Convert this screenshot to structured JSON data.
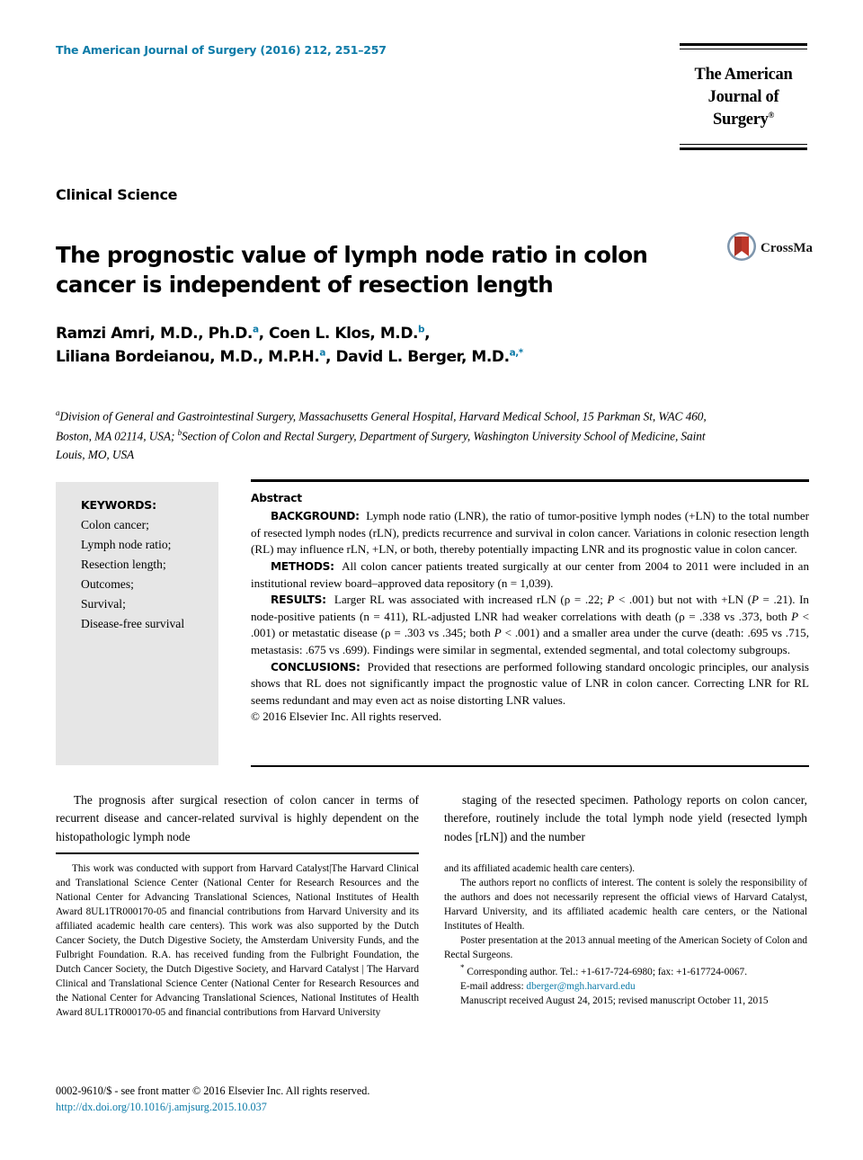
{
  "header": {
    "journal_reference": "The American Journal of Surgery (2016) 212, 251–257",
    "masthead_line1": "The American",
    "masthead_line2": "Journal of Surgery",
    "masthead_registered": "®"
  },
  "article": {
    "section_label": "Clinical Science",
    "title": "The prognostic value of lymph node ratio in colon cancer is independent of resection length",
    "crossmark_label": "CrossMark",
    "crossmark_ring_color": "#5a7fa6",
    "crossmark_ribbon_color": "#c0392b",
    "accent_color": "#0d7ba8"
  },
  "authors": {
    "line1": "Ramzi Amri, M.D., Ph.D.",
    "line1_sup1": "a",
    "line1_mid": ", Coen L. Klos, M.D.",
    "line1_sup2": "b",
    "line1_end": ",",
    "line2": "Liliana Bordeianou, M.D., M.P.H.",
    "line2_sup1": "a",
    "line2_mid": ", David L. Berger, M.D.",
    "line2_sup2": "a,*"
  },
  "affiliations": {
    "sup_a": "a",
    "text_a": "Division of General and Gastrointestinal Surgery, Massachusetts General Hospital, Harvard Medical School, 15 Parkman St, WAC 460, Boston, MA 02114, USA; ",
    "sup_b": "b",
    "text_b": "Section of Colon and Rectal Surgery, Department of Surgery, Washington University School of Medicine, Saint Louis, MO, USA"
  },
  "keywords": {
    "title": "KEYWORDS:",
    "items": [
      "Colon cancer;",
      "Lymph node ratio;",
      "Resection length;",
      "Outcomes;",
      "Survival;",
      "Disease-free survival"
    ]
  },
  "abstract": {
    "heading": "Abstract",
    "background_label": "BACKGROUND:",
    "background_text": "Lymph node ratio (LNR), the ratio of tumor-positive lymph nodes (+LN) to the total number of resected lymph nodes (rLN), predicts recurrence and survival in colon cancer. Variations in colonic resection length (RL) may influence rLN, +LN, or both, thereby potentially impacting LNR and its prognostic value in colon cancer.",
    "methods_label": "METHODS:",
    "methods_text": "All colon cancer patients treated surgically at our center from 2004 to 2011 were included in an institutional review board–approved data repository (n = 1,039).",
    "results_label": "RESULTS:",
    "results_text_1": "Larger RL was associated with increased rLN (ρ = .22; ",
    "results_p1": "P",
    "results_text_2": " < .001) but not with +LN (",
    "results_p2": "P",
    "results_text_3": " = .21). In node-positive patients (n = 411), RL-adjusted LNR had weaker correlations with death (ρ = .338 vs .373, both ",
    "results_p3": "P",
    "results_text_4": " < .001) or metastatic disease (ρ = .303 vs .345; both ",
    "results_p4": "P",
    "results_text_5": " < .001) and a smaller area under the curve (death: .695 vs .715, metastasis: .675 vs .699). Findings were similar in segmental, extended segmental, and total colectomy subgroups.",
    "conclusions_label": "CONCLUSIONS:",
    "conclusions_text": "Provided that resections are performed following standard oncologic principles, our analysis shows that RL does not significantly impact the prognostic value of LNR in colon cancer. Correcting LNR for RL seems redundant and may even act as noise distorting LNR values.",
    "copyright": "© 2016 Elsevier Inc. All rights reserved."
  },
  "body": {
    "left_column": "The prognosis after surgical resection of colon cancer in terms of recurrent disease and cancer-related survival is highly dependent on the histopathologic lymph node",
    "right_column": "staging of the resected specimen. Pathology reports on colon cancer, therefore, routinely include the total lymph node yield (resected lymph nodes [rLN]) and the number"
  },
  "footnotes": {
    "left_para_1": "This work was conducted with support from Harvard Catalyst|The Harvard Clinical and Translational Science Center (National Center for Research Resources and the National Center for Advancing Translational Sciences, National Institutes of Health Award 8UL1TR000170-05 and financial contributions from Harvard University and its affiliated academic health care centers). This work was also supported by the Dutch Cancer Society, the Dutch Digestive Society, the Amsterdam University Funds, and the Fulbright Foundation. R.A. has received funding from the Fulbright Foundation, the Dutch Cancer Society, the Dutch Digestive Society, and Harvard Catalyst | The Harvard Clinical and Translational Science Center (National Center for Research Resources and the National Center for Advancing Translational Sciences, National Institutes of Health Award 8UL1TR000170-05 and financial contributions from Harvard University",
    "right_para_1": "and its affiliated academic health care centers).",
    "right_para_2": "The authors report no conflicts of interest. The content is solely the responsibility of the authors and does not necessarily represent the official views of Harvard Catalyst, Harvard University, and its affiliated academic health care centers, or the National Institutes of Health.",
    "right_para_3": "Poster presentation at the 2013 annual meeting of the American Society of Colon and Rectal Surgeons.",
    "right_corresponding_star": "*",
    "right_corresponding": " Corresponding author. Tel.: +1-617-724-6980; fax: +1-617724-0067.",
    "right_email_label": "E-mail address: ",
    "right_email": "dberger@mgh.harvard.edu",
    "right_manuscript": "Manuscript received August 24, 2015; revised manuscript October 11, 2015"
  },
  "page_footer": {
    "issn_line": "0002-9610/$ - see front matter © 2016 Elsevier Inc. All rights reserved.",
    "doi_line": "http://dx.doi.org/10.1016/j.amjsurg.2015.10.037"
  }
}
